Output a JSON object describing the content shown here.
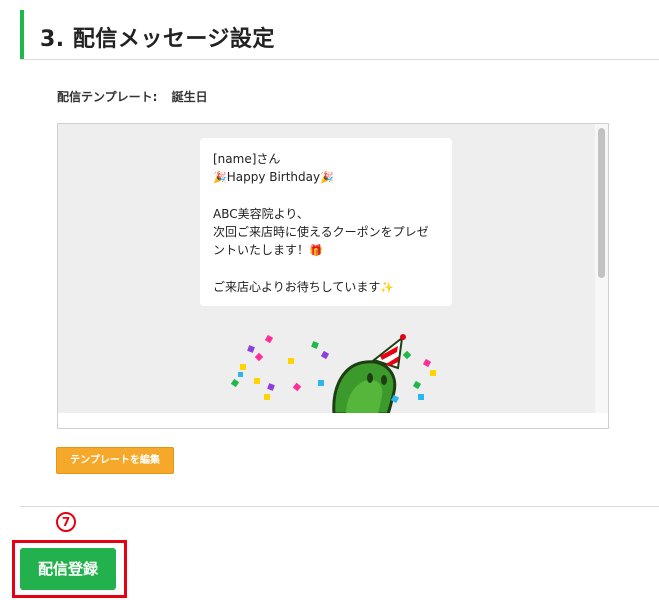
{
  "section": {
    "title": "3. 配信メッセージ設定"
  },
  "template": {
    "label": "配信テンプレート:",
    "value": "誕生日"
  },
  "message": {
    "line1": "[name]さん",
    "line2_emoji_left": "🎉",
    "line2_text": "Happy Birthday",
    "line2_emoji_right": "🎉",
    "line3": "ABC美容院より、",
    "line4": "次回ご来店時に使えるクーポンをプレゼ",
    "line5_text": "ントいたします！",
    "line5_emoji": "🎁",
    "line6_text": "ご来店心よりお待ちしています",
    "line6_emoji": "✨"
  },
  "buttons": {
    "edit_template": "テンプレートを編集",
    "register": "配信登録"
  },
  "annotation": {
    "step_number": "⑦",
    "color": "#e60012"
  },
  "colors": {
    "accent_green": "#1fb84a",
    "button_green": "#22b14c",
    "button_orange": "#f6a82b",
    "preview_bg": "#eeeeee"
  },
  "icons": {
    "sticker": "birthday-character-sticker",
    "party": "party-popper-icon",
    "gift": "gift-icon",
    "sparkles": "sparkles-icon"
  }
}
